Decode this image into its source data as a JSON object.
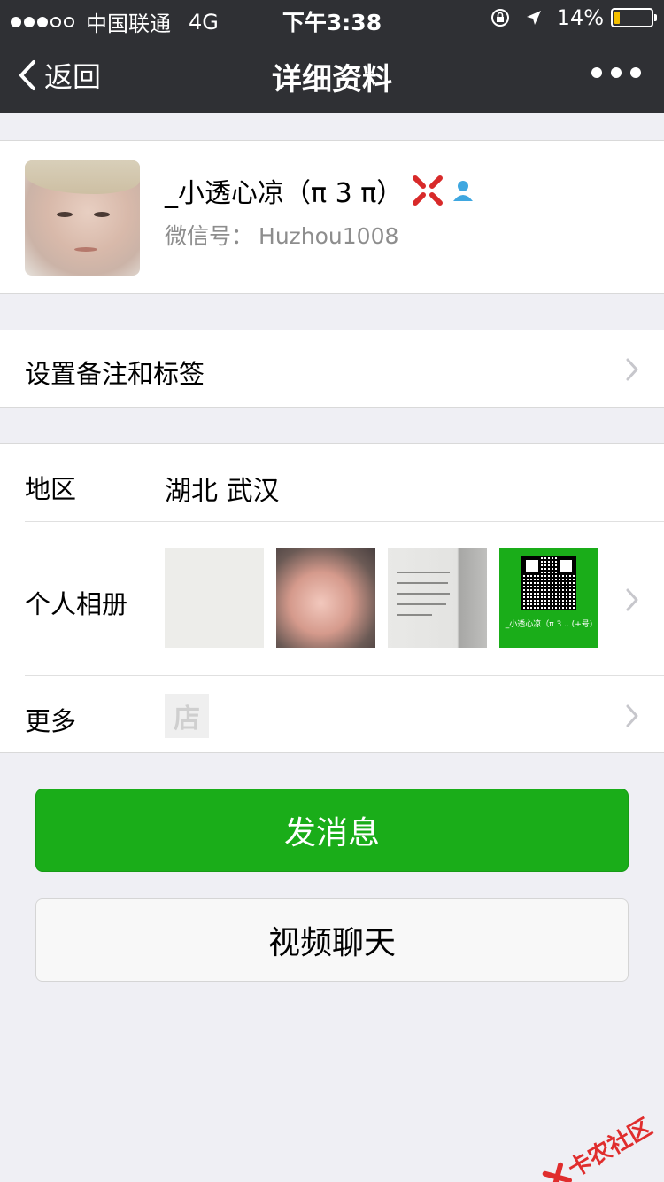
{
  "status_bar": {
    "signal_full": 3,
    "signal_empty": 2,
    "carrier": "中国联通",
    "network": "4G",
    "time": "下午3:38",
    "battery_text": "14%",
    "battery_level": 0.14
  },
  "nav": {
    "back_label": "返回",
    "title": "详细资料"
  },
  "profile": {
    "name": "_小透心凉（π 3 π）",
    "wechat_id_label": "微信号：",
    "wechat_id": "Huzhou1008"
  },
  "remark_row": {
    "label": "设置备注和标签"
  },
  "region_row": {
    "label": "地区",
    "value": "湖北 武汉"
  },
  "album_row": {
    "label": "个人相册",
    "qr_caption": "_小透心凉（π 3 .. (+号)"
  },
  "more_row": {
    "label": "更多",
    "store_glyph": "店"
  },
  "buttons": {
    "send_message": "发消息",
    "video_chat": "视频聊天"
  },
  "watermark": {
    "text": "卡农社区"
  },
  "colors": {
    "topbar": "#2f3034",
    "primary_green": "#1aad19",
    "background": "#efeff4",
    "battery": "#f4c000"
  }
}
